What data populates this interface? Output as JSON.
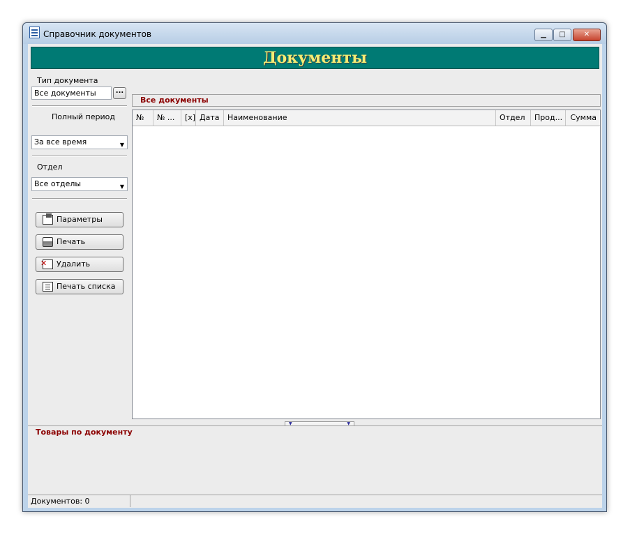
{
  "window": {
    "title": "Справочник документов",
    "minimize_glyph": "▁",
    "maximize_glyph": "□",
    "close_glyph": "✕"
  },
  "banner": {
    "title": "Документы",
    "background": "#007a74",
    "text_color": "#f4ec74"
  },
  "filters": {
    "doc_type_label": "Тип документа",
    "doc_type_value": "Все документы",
    "doc_type_button": "...",
    "period_label": "Полный период",
    "period_selected": "За все время",
    "department_label": "Отдел",
    "department_selected": "Все отделы"
  },
  "actions": [
    {
      "label": "Параметры",
      "icon": "parameters-icon"
    },
    {
      "label": "Печать",
      "icon": "printer-icon"
    },
    {
      "label": "Удалить",
      "icon": "delete-icon"
    },
    {
      "label": "Печать списка",
      "icon": "print-list-icon"
    }
  ],
  "documents": {
    "header": "Все документы",
    "columns": [
      "№",
      "№ ...",
      "[x]",
      "Дата",
      "Наименование",
      "Отдел",
      "Прод...",
      "Сумма"
    ],
    "rows": []
  },
  "goods": {
    "title": "Товары по документу"
  },
  "status": {
    "count_text": "Документов: 0"
  },
  "colors": {
    "section_title": "#8b0000"
  }
}
